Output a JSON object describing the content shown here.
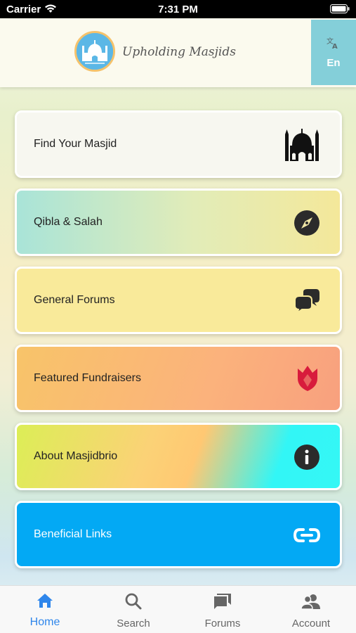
{
  "status_bar": {
    "carrier": "Carrier",
    "time": "7:31 PM"
  },
  "header": {
    "brand_title": "Upholding Masjids",
    "language_label": "En",
    "logo_icon": "mosque-logo-icon",
    "language_icon": "translate-icon"
  },
  "menu": [
    {
      "label": "Find Your Masjid",
      "icon": "mosque-icon"
    },
    {
      "label": "Qibla & Salah",
      "icon": "compass-icon"
    },
    {
      "label": "General Forums",
      "icon": "chat-bubbles-icon"
    },
    {
      "label": "Featured Fundraisers",
      "icon": "tulip-icon"
    },
    {
      "label": "About Masjidbrio",
      "icon": "info-icon"
    },
    {
      "label": "Beneficial Links",
      "icon": "link-icon"
    }
  ],
  "bottom_nav": [
    {
      "label": "Home",
      "icon": "home-icon",
      "active": true
    },
    {
      "label": "Search",
      "icon": "search-icon",
      "active": false
    },
    {
      "label": "Forums",
      "icon": "forum-icon",
      "active": false
    },
    {
      "label": "Account",
      "icon": "account-icon",
      "active": false
    }
  ],
  "colors": {
    "active_tab": "#2f86eb",
    "links_card": "#03a9f4",
    "language_button": "#84cfd9",
    "tulip": "#d81b3c"
  }
}
